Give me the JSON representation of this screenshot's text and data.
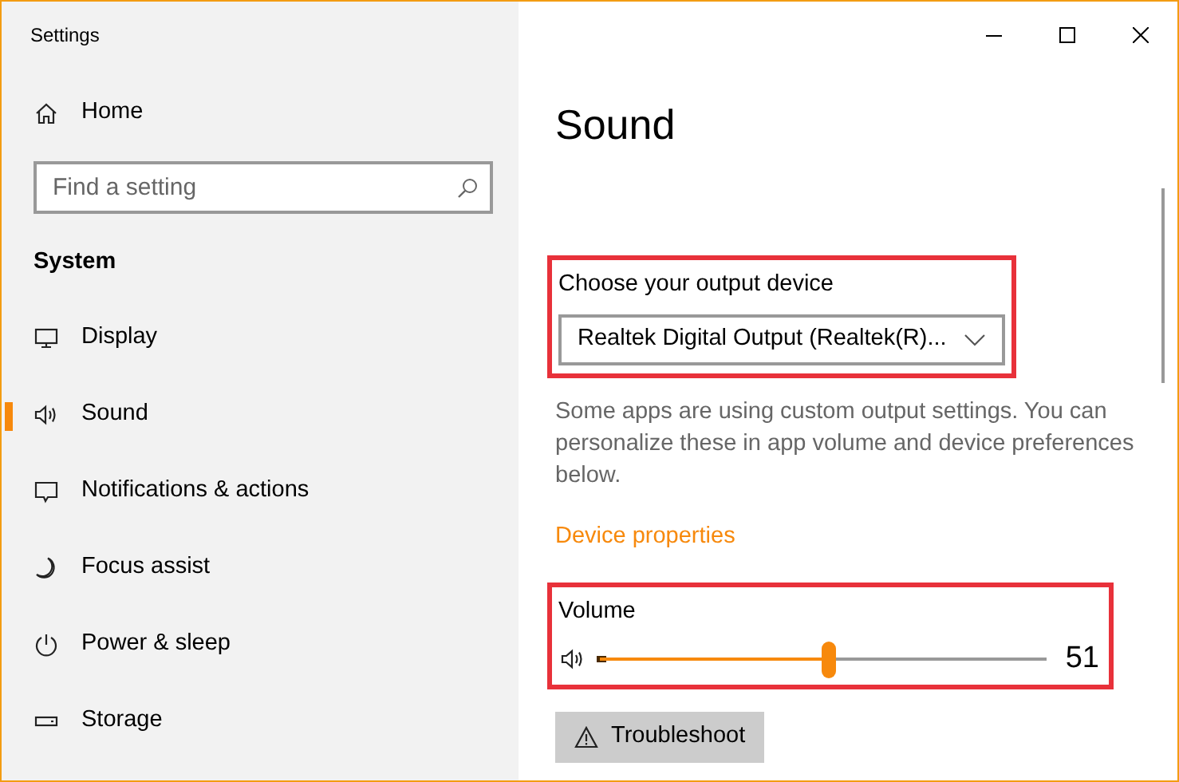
{
  "window": {
    "title": "Settings",
    "controls": [
      {
        "kind": "minimize"
      },
      {
        "kind": "maximize"
      },
      {
        "kind": "close"
      }
    ]
  },
  "sidebar": {
    "home": {
      "label": "Home"
    },
    "search": {
      "placeholder": "Find a setting"
    },
    "section": "System",
    "items": [
      {
        "label": "Display",
        "selected": false
      },
      {
        "label": "Sound",
        "selected": true
      },
      {
        "label": "Notifications & actions",
        "selected": false
      },
      {
        "label": "Focus assist",
        "selected": false
      },
      {
        "label": "Power & sleep",
        "selected": false
      },
      {
        "label": "Storage",
        "selected": false
      }
    ]
  },
  "content": {
    "heading": "Sound",
    "output": {
      "highlighted": true,
      "label": "Choose your output device",
      "value": "Realtek Digital Output (Realtek(R)..."
    },
    "note": "Some apps are using custom output settings. You can personalize these in app volume and device preferences below.",
    "link": "Device properties",
    "volume": {
      "highlighted": true,
      "label": "Volume",
      "level": 0.51,
      "reading": "51"
    },
    "button": "Troubleshoot"
  }
}
